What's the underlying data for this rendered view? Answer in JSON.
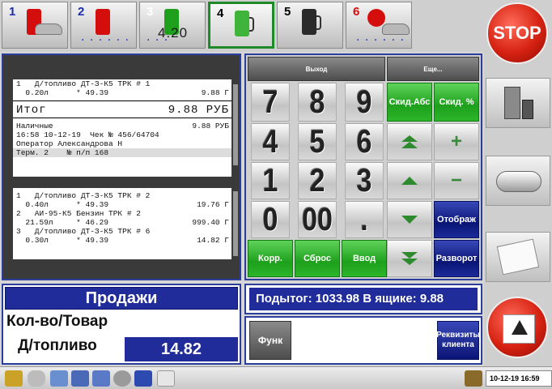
{
  "pumps": [
    {
      "num": "1",
      "color": "#d40d0d",
      "extra": ""
    },
    {
      "num": "2",
      "color": "#d40d0d",
      "extra": "",
      "dots": ". . . . . ."
    },
    {
      "num": "3",
      "color": "#ffffff",
      "extra": "4.20",
      "dots": ". . ."
    },
    {
      "num": "4",
      "color": "#000000",
      "extra": ""
    },
    {
      "num": "5",
      "color": "#000000",
      "extra": ""
    },
    {
      "num": "6",
      "color": "#d40d0d",
      "extra": "",
      "dots": ". . . . . ."
    }
  ],
  "stop_label": "STOP",
  "receipt_top": {
    "line1": "1   Д/топливо ДТ-З-К5 ТРК # 1",
    "line2": "  0.20л      * 49.39",
    "line2_right": "9.88 Г",
    "total_label": "Итог",
    "total_value": "9.88 РУБ",
    "line3": "Наличные",
    "line3_right": "9.88 РУБ",
    "line4": "16:58 10-12-19  Чек № 456/64704",
    "line5": "Оператор Александрова Н",
    "line6": "Терм. 2    № п/п 168"
  },
  "receipt_bottom": [
    {
      "a": "1   Д/топливо ДТ-З-К5 ТРК # 2",
      "b": "  0.40л      * 49.39",
      "br": "19.76 Г"
    },
    {
      "a": "2   АИ-95-К5 Бензин ТРК # 2",
      "b": "  21.59л     * 46.29",
      "br": "999.40 Г"
    },
    {
      "a": "3   Д/топливо ДТ-З-К5 ТРК # 6",
      "b": "  0.30л      * 49.39",
      "br": "14.82 Г"
    }
  ],
  "keypad": {
    "exit": "Выход",
    "more": "Еще...",
    "d7": "7",
    "d8": "8",
    "d9": "9",
    "d4": "4",
    "d5": "5",
    "d6": "6",
    "d1": "1",
    "d2": "2",
    "d3": "3",
    "d0": "0",
    "d00": "00",
    "dot": ".",
    "disc_abs": "Скид.Абс",
    "disc_pct": "Скид. %",
    "plus": "+",
    "minus": "−",
    "display": "Отображ",
    "korr": "Корр.",
    "reset": "Сброс",
    "enter": "Ввод",
    "spread": "Разворот"
  },
  "sales": {
    "title": "Продажи",
    "qty_label": "Кол-во/Товар",
    "product": "Д/топливо",
    "price": "14.82"
  },
  "subtotal": "Подытог: 1033.98  В ящике: 9.88",
  "func_label": "Функ",
  "client_req": "Реквизиты клиента",
  "clock": "10-12-19 16:59"
}
